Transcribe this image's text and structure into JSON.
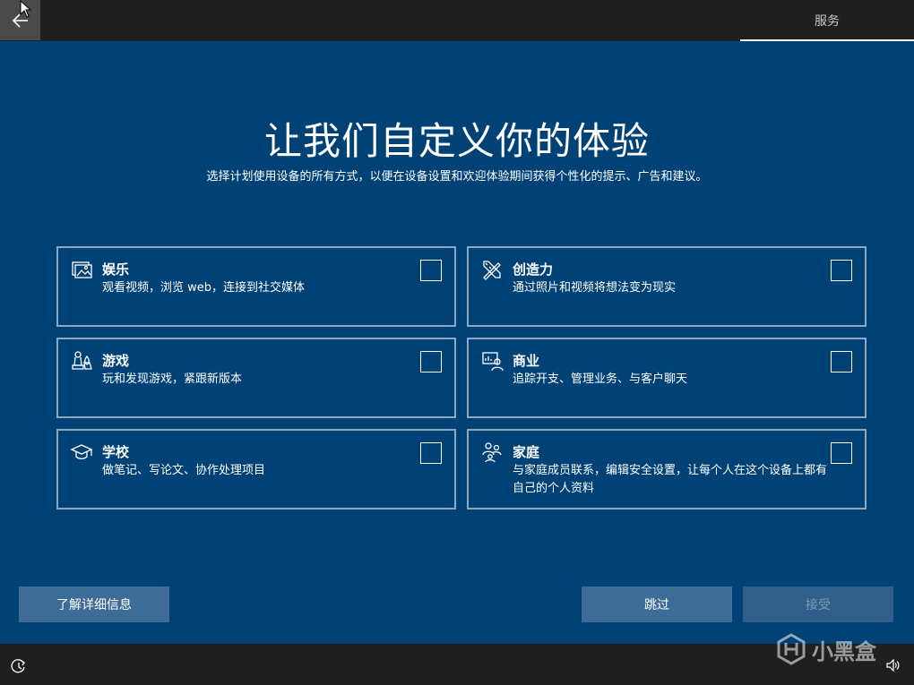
{
  "header": {
    "step_tab": "服务"
  },
  "main": {
    "title": "让我们自定义你的体验",
    "subtitle": "选择计划使用设备的所有方式，以便在设备设置和欢迎体验期间获得个性化的提示、广告和建议。"
  },
  "cards": [
    {
      "name": "娱乐",
      "desc": "观看视频，浏览 web，连接到社交媒体",
      "icon": "picture-icon",
      "checked": false
    },
    {
      "name": "创造力",
      "desc": "通过照片和视频将想法变为现实",
      "icon": "brush-ruler-icon",
      "checked": false
    },
    {
      "name": "游戏",
      "desc": "玩和发现游戏，紧跟新版本",
      "icon": "game-pieces-icon",
      "checked": false
    },
    {
      "name": "商业",
      "desc": "追踪开支、管理业务、与客户聊天",
      "icon": "business-person-icon",
      "checked": false
    },
    {
      "name": "学校",
      "desc": "做笔记、写论文、协作处理项目",
      "icon": "graduation-cap-icon",
      "checked": false
    },
    {
      "name": "家庭",
      "desc": "与家庭成员联系，编辑安全设置，让每个人在这个设备上都有自己的个人资料",
      "icon": "family-icon",
      "checked": false
    }
  ],
  "buttons": {
    "learn_more": "了解详细信息",
    "skip": "跳过",
    "accept": "接受"
  },
  "watermark": {
    "text": "小黑盒"
  },
  "colors": {
    "background": "#004275",
    "button": "#3c6c97",
    "bar": "#1f1f1f",
    "card_border": "#8fa8c0"
  }
}
